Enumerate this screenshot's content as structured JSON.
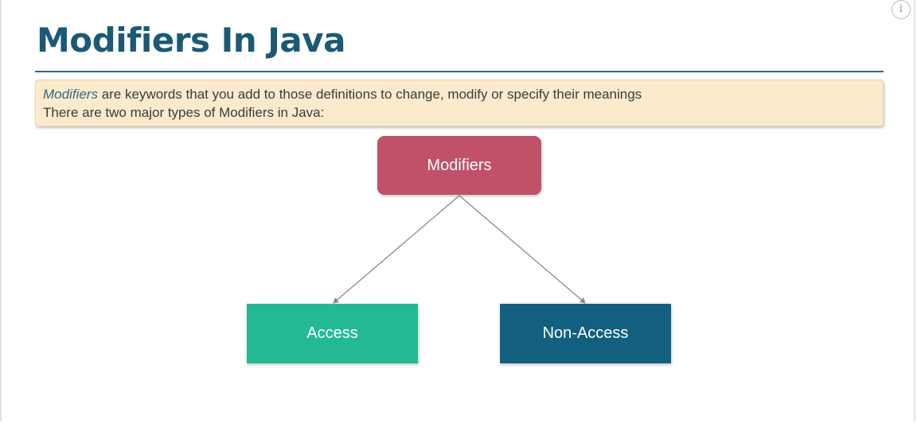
{
  "slide": {
    "title": "Modifiers In Java",
    "info_label": "i"
  },
  "callout": {
    "term": "Modifiers",
    "line1_rest": " are keywords that you add to those definitions to change, modify or specify their meanings",
    "line2": "There are two major types of Modifiers in Java:"
  },
  "diagram": {
    "root": "Modifiers",
    "children": [
      "Access",
      "Non-Access"
    ],
    "colors": {
      "root": "#c05168",
      "access": "#24b994",
      "non_access": "#125f7f",
      "connector": "#8a8a8a"
    }
  }
}
